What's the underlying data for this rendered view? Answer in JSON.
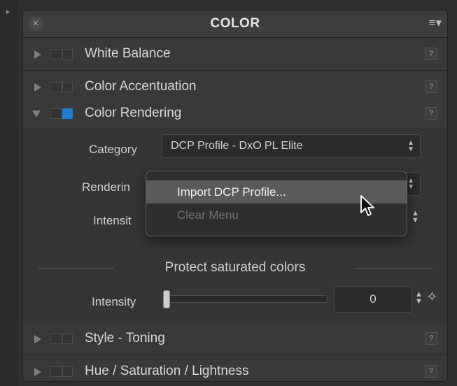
{
  "panel": {
    "title": "COLOR",
    "close_icon": "×",
    "menu_icon": "≡▾"
  },
  "sections": {
    "white_balance": {
      "label": "White Balance",
      "help": "?"
    },
    "color_accentuation": {
      "label": "Color Accentuation",
      "help": "?"
    },
    "color_rendering": {
      "label": "Color Rendering",
      "help": "?",
      "expanded": true,
      "enabled": true
    },
    "style_toning": {
      "label": "Style - Toning",
      "help": "?"
    },
    "hsl": {
      "label": "Hue / Saturation / Lightness",
      "help": "?"
    }
  },
  "color_rendering": {
    "category_label": "Category",
    "category_value": "DCP Profile - DxO PL Elite",
    "rendering_label": "Renderin",
    "intensity_label": "Intensit",
    "protect_title": "Protect saturated colors",
    "protect_intensity_label": "Intensity",
    "protect_intensity_value": "0",
    "protect_intensity_fraction": 0.0
  },
  "popup_menu": {
    "items": [
      {
        "label": "Import DCP Profile...",
        "highlighted": true,
        "enabled": true
      },
      {
        "label": "Clear Menu",
        "highlighted": false,
        "enabled": false
      }
    ]
  },
  "colors": {
    "accent": "#1e7bd4",
    "panel_bg": "#363636",
    "highlight": "#5a5a5a"
  },
  "icons": [
    "close-icon",
    "menu-icon",
    "disclosure-triangle-icon",
    "help-icon",
    "updown-arrows-icon",
    "magic-wand-icon",
    "mouse-pointer-icon"
  ]
}
